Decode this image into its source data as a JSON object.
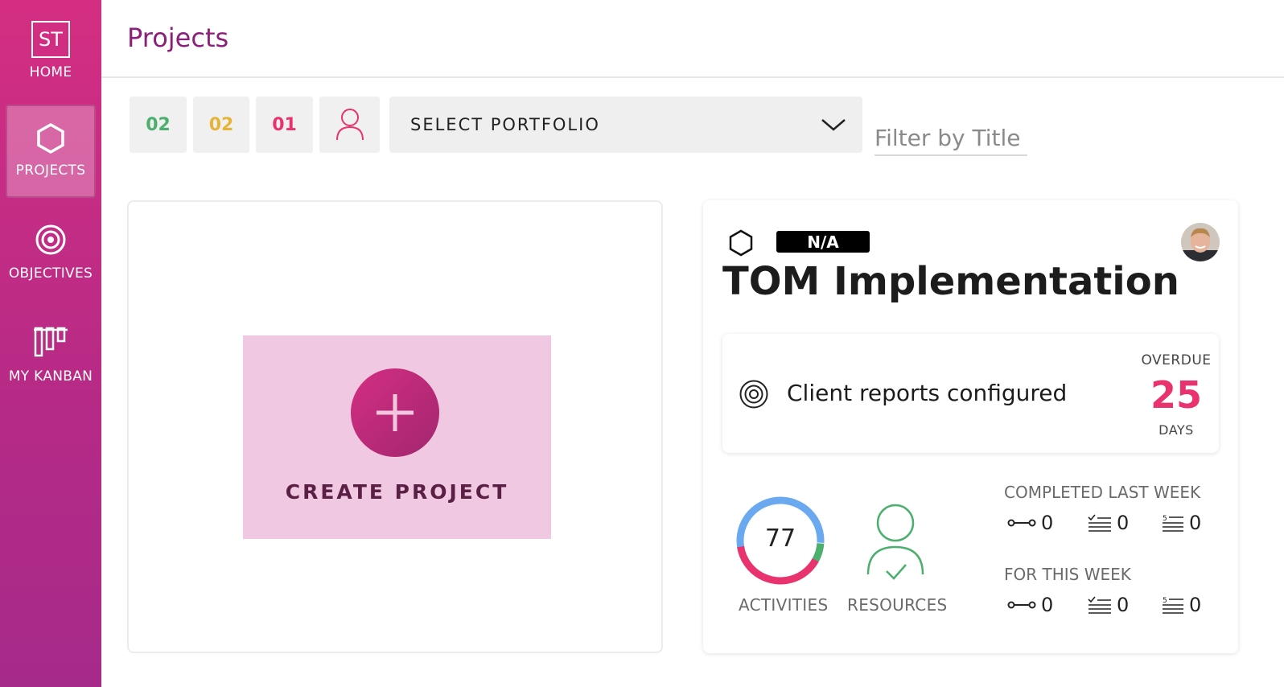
{
  "sidebar": {
    "logo": "ST",
    "items": [
      {
        "label": "HOME",
        "icon": "home-logo"
      },
      {
        "label": "PROJECTS",
        "icon": "hexagon-icon",
        "active": true
      },
      {
        "label": "OBJECTIVES",
        "icon": "target-icon"
      },
      {
        "label": "MY KANBAN",
        "icon": "kanban-icon"
      }
    ]
  },
  "header": {
    "title": "Projects"
  },
  "toolbar": {
    "counts": [
      {
        "value": "02",
        "color": "#4caf6e"
      },
      {
        "value": "02",
        "color": "#e6b537"
      },
      {
        "value": "01",
        "color": "#e8336f"
      }
    ],
    "person_filter_icon": "person-icon",
    "portfolio": {
      "selected": "SELECT PORTFOLIO"
    },
    "filter": {
      "placeholder": "Filter by Title"
    }
  },
  "create": {
    "label": "CREATE PROJECT"
  },
  "project": {
    "badge": "N/A",
    "title": "TOM Implementation",
    "objective": {
      "text": "Client reports configured",
      "overdue_label": "OVERDUE",
      "overdue_value": "25",
      "days_label": "DAYS"
    },
    "activities": {
      "value": "77",
      "label": "ACTIVITIES"
    },
    "resources": {
      "label": "RESOURCES"
    },
    "completed_last_week": {
      "label": "COMPLETED LAST WEEK",
      "milestones": "0",
      "tasks": "0",
      "items": "0"
    },
    "for_this_week": {
      "label": "FOR THIS WEEK",
      "milestones": "0",
      "tasks": "0",
      "items": "0"
    }
  },
  "colors": {
    "brand": "#d42e82",
    "title": "#8b1f7a",
    "overdue": "#e8336f",
    "donut_blue": "#6aa9f0",
    "donut_red": "#e8336f",
    "donut_green": "#4caf6e"
  }
}
